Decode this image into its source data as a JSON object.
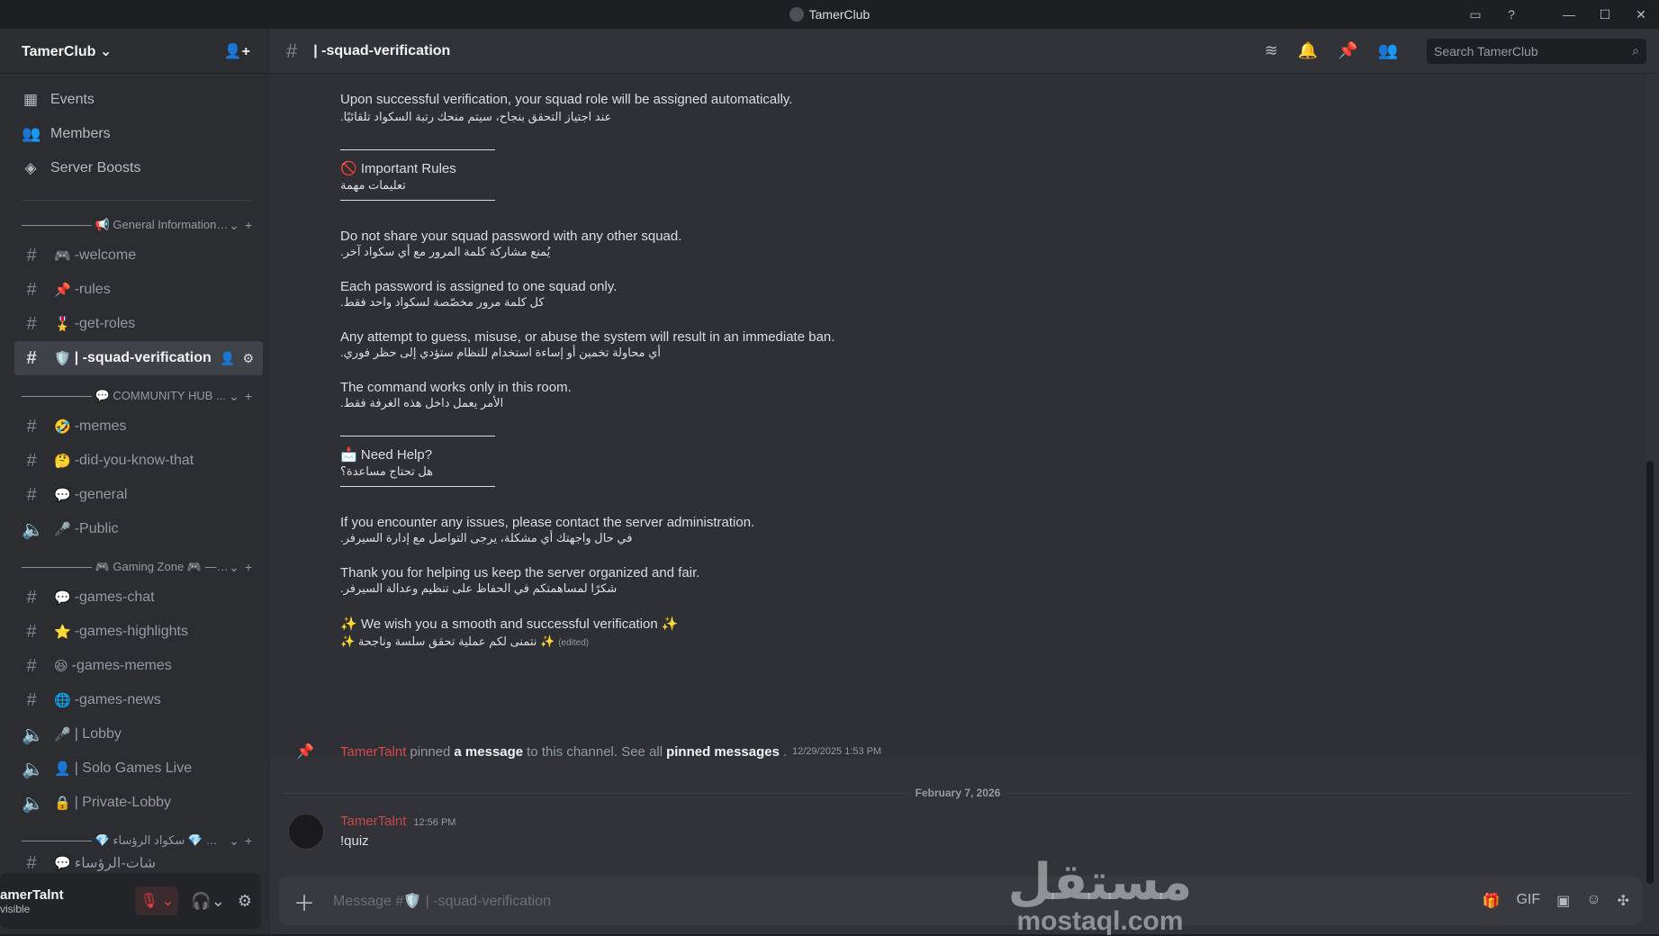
{
  "window": {
    "title": "TamerClub"
  },
  "server": {
    "name": "TamerClub ⌄"
  },
  "nav_top": [
    {
      "label": "Events",
      "icon": "calendar-icon"
    },
    {
      "label": "Members",
      "icon": "members-icon"
    },
    {
      "label": "Server Boosts",
      "icon": "boost-icon"
    }
  ],
  "categories": {
    "general": "——————  📢 General Information ...",
    "community": "——————  💬 COMMUNITY HUB ...",
    "gaming": "——————  🎮 Gaming Zone 🎮 ——...",
    "squad": "——————  💎 سكواد الرؤساء 💎 ——————..."
  },
  "channels": {
    "welcome": {
      "emoji": "🎮",
      "label": "-welcome"
    },
    "rules": {
      "emoji": "📌",
      "label": "-rules"
    },
    "get_roles": {
      "emoji": "🎖️",
      "label": "-get-roles"
    },
    "squad_verification": {
      "emoji": "🛡️",
      "label": "| -squad-verification"
    },
    "memes": {
      "emoji": "🤣",
      "label": "-memes"
    },
    "did_you_know": {
      "emoji": "🤔",
      "label": "-did-you-know-that"
    },
    "general_chat": {
      "emoji": "💬",
      "label": "-general"
    },
    "public": {
      "emoji": "🎤",
      "label": "-Public"
    },
    "games_chat": {
      "emoji": "💬",
      "label": "-games-chat"
    },
    "games_highlights": {
      "emoji": "⭐",
      "label": "-games-highlights"
    },
    "games_memes": {
      "emoji": "😆",
      "label": "-games-memes"
    },
    "games_news": {
      "emoji": "🌐",
      "label": "-games-news"
    },
    "lobby": {
      "emoji": "🎤",
      "label": "|  Lobby"
    },
    "solo_games": {
      "emoji": "👤",
      "label": "|  Solo Games Live"
    },
    "private_lobby": {
      "emoji": "🔒",
      "label": "|  Private-Lobby"
    },
    "cut_off": {
      "emoji": "💬",
      "label": "شات-الرؤساء"
    }
  },
  "user": {
    "name": "amerTalnt",
    "status": "visible"
  },
  "header": {
    "channel_name": "| -squad-verification",
    "search_placeholder": "Search TamerClub"
  },
  "message_lines": {
    "l1": "Upon successful verification, your squad role will be assigned automatically.",
    "l1_ar": "عند اجتياز التحقق بنجاح، سيتم منحك رتبة السكواد تلقائيًا.",
    "rules_title": "Important Rules",
    "rules_title_ar": "تعليمات مهمة",
    "r1": "Do not share your squad password with any other squad.",
    "r1_ar": "يُمنع مشاركة كلمة المرور مع أي سكواد آخر.",
    "r2": "Each password is assigned to one squad only.",
    "r2_ar": "كل كلمة مرور مخصّصة لسكواد واحد فقط.",
    "r3": "Any attempt to guess, misuse, or abuse the system will result in an immediate ban.",
    "r3_ar": "أي محاولة تخمين أو إساءة استخدام للنظام ستؤدي إلى حظر فوري.",
    "r4": "The command works only in this room.",
    "r4_ar": "الأمر يعمل داخل هذه الغرفة فقط.",
    "help_title": "Need Help?",
    "help_title_ar": "هل تحتاج مساعدة؟",
    "h1": "If you encounter any issues, please contact the server administration.",
    "h1_ar": "في حال واجهتك أي مشكلة، يرجى التواصل مع إدارة السيرفر.",
    "t1": "Thank you for helping us keep the server organized and fair.",
    "t1_ar": "شكرًا لمساهمتكم في الحفاظ على تنظيم وعدالة السيرفر.",
    "w1": "✨ We wish you a smooth and successful verification ✨",
    "w1_ar": "✨ نتمنى لكم عملية تحقق سلسة وناجحة ✨",
    "edited": "(edited)"
  },
  "pin_notice": {
    "author": "TamerTalnt",
    "text1": "pinned",
    "link1": "a message",
    "text2": "to this channel. See all",
    "link2": "pinned messages",
    "text3": ".",
    "timestamp": "12/29/2025 1:53 PM"
  },
  "date_divider": "February 7, 2026",
  "last_message": {
    "author": "TamerTalnt",
    "timestamp": "12:56 PM",
    "content": "!quiz"
  },
  "composer": {
    "placeholder": "Message #🛡️ | -squad-verification"
  },
  "watermark": {
    "ar": "مستقل",
    "en": "mostaql.com"
  }
}
